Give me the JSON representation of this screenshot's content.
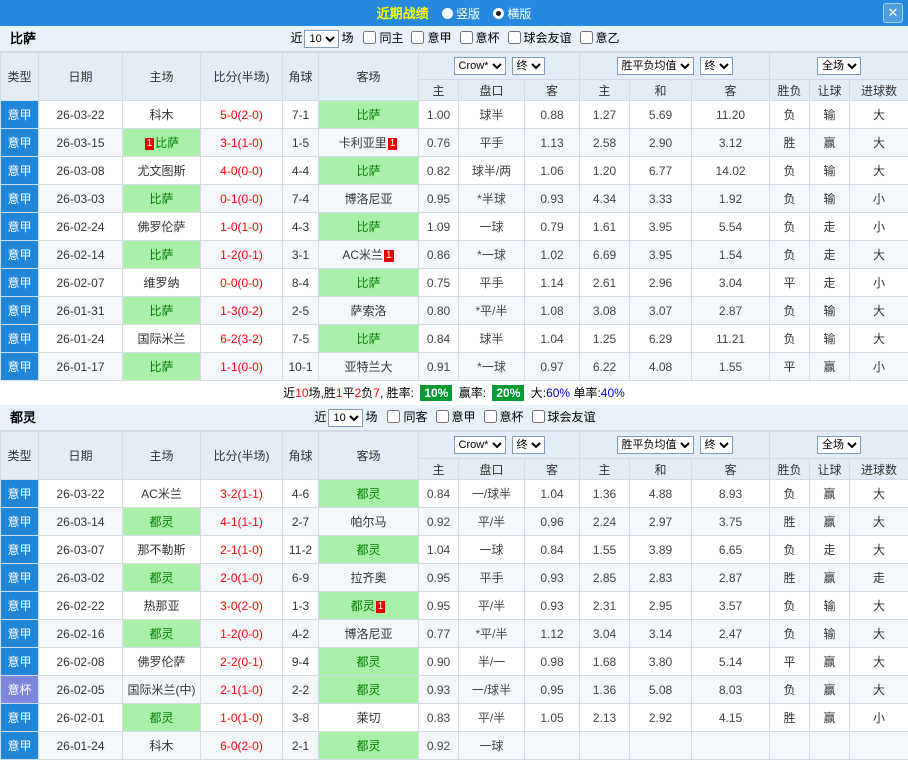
{
  "titlebar": {
    "title": "近期战绩",
    "options": [
      {
        "label": "竖版",
        "selected": false
      },
      {
        "label": "横版",
        "selected": true
      }
    ],
    "close_icon": "✕"
  },
  "controls_labels": {
    "near": "近",
    "count": "10",
    "games": "场"
  },
  "table_header": {
    "cols": [
      "类型",
      "日期",
      "主场",
      "比分(半场)",
      "角球",
      "客场"
    ],
    "odds_select": "Crow*",
    "final_select": "终",
    "avg_select": "胜平负均值",
    "avg_final_select": "终",
    "scope_select": "全场",
    "odds_cols": [
      "主",
      "盘口",
      "客"
    ],
    "avg_cols": [
      "主",
      "和",
      "客"
    ],
    "result_cols": [
      "胜负",
      "让球",
      "进球数"
    ]
  },
  "colors": {
    "titlebar_bg": "#2589e0",
    "league_cell": "#2186d7",
    "cup_cell": "#7d88dd",
    "team_highlight": "#a9f0a9",
    "score_text": "#ff0000",
    "win": "#ff0000",
    "draw": "#0000e0",
    "loss": "#009933",
    "rate_badge_bg": "#009933"
  },
  "sections": [
    {
      "team": "比萨",
      "checkboxes": [
        {
          "label": "同主",
          "checked": false
        },
        {
          "label": "意甲",
          "checked": false
        },
        {
          "label": "意杯",
          "checked": false
        },
        {
          "label": "球会友谊",
          "checked": false
        },
        {
          "label": "意乙",
          "checked": false
        }
      ],
      "rows": [
        {
          "type": "意甲",
          "date": "26-03-22",
          "home": "科木",
          "home_hl": false,
          "home_badge": "",
          "score": "5-0(2-0)",
          "corner": "7-1",
          "away": "比萨",
          "away_hl": true,
          "away_badge": "",
          "odds": [
            "1.00",
            "球半",
            "0.88"
          ],
          "avg": [
            "1.27",
            "5.69",
            "11.20"
          ],
          "res": [
            [
              "负",
              "g"
            ],
            [
              "输",
              "g"
            ],
            [
              "大",
              "r"
            ]
          ]
        },
        {
          "type": "意甲",
          "date": "26-03-15",
          "home": "比萨",
          "home_hl": true,
          "home_badge": "1",
          "home_badge_pos": "before",
          "score": "3-1(1-0)",
          "corner": "1-5",
          "away": "卡利亚里",
          "away_hl": false,
          "away_badge": "1",
          "odds": [
            "0.76",
            "平手",
            "1.13"
          ],
          "avg": [
            "2.58",
            "2.90",
            "3.12"
          ],
          "res": [
            [
              "胜",
              "r"
            ],
            [
              "赢",
              "r"
            ],
            [
              "大",
              "r"
            ]
          ]
        },
        {
          "type": "意甲",
          "date": "26-03-08",
          "home": "尤文图斯",
          "home_hl": false,
          "home_badge": "",
          "score": "4-0(0-0)",
          "corner": "4-4",
          "away": "比萨",
          "away_hl": true,
          "away_badge": "",
          "odds": [
            "0.82",
            "球半/两",
            "1.06"
          ],
          "avg": [
            "1.20",
            "6.77",
            "14.02"
          ],
          "res": [
            [
              "负",
              "g"
            ],
            [
              "输",
              "g"
            ],
            [
              "大",
              "r"
            ]
          ]
        },
        {
          "type": "意甲",
          "date": "26-03-03",
          "home": "比萨",
          "home_hl": true,
          "home_badge": "",
          "score": "0-1(0-0)",
          "corner": "7-4",
          "away": "博洛尼亚",
          "away_hl": false,
          "away_badge": "",
          "odds": [
            "0.95",
            "*半球",
            "0.93"
          ],
          "avg": [
            "4.34",
            "3.33",
            "1.92"
          ],
          "res": [
            [
              "负",
              "g"
            ],
            [
              "输",
              "g"
            ],
            [
              "小",
              "g"
            ]
          ]
        },
        {
          "type": "意甲",
          "date": "26-02-24",
          "home": "佛罗伦萨",
          "home_hl": false,
          "home_badge": "",
          "score": "1-0(1-0)",
          "corner": "4-3",
          "away": "比萨",
          "away_hl": true,
          "away_badge": "",
          "odds": [
            "1.09",
            "一球",
            "0.79"
          ],
          "avg": [
            "1.61",
            "3.95",
            "5.54"
          ],
          "res": [
            [
              "负",
              "g"
            ],
            [
              "走",
              "b"
            ],
            [
              "小",
              "g"
            ]
          ]
        },
        {
          "type": "意甲",
          "date": "26-02-14",
          "home": "比萨",
          "home_hl": true,
          "home_badge": "",
          "score": "1-2(0-1)",
          "corner": "3-1",
          "away": "AC米兰",
          "away_hl": false,
          "away_badge": "1",
          "odds": [
            "0.86",
            "*一球",
            "1.02"
          ],
          "avg": [
            "6.69",
            "3.95",
            "1.54"
          ],
          "res": [
            [
              "负",
              "g"
            ],
            [
              "走",
              "b"
            ],
            [
              "大",
              "r"
            ]
          ]
        },
        {
          "type": "意甲",
          "date": "26-02-07",
          "home": "维罗纳",
          "home_hl": false,
          "home_badge": "",
          "score": "0-0(0-0)",
          "corner": "8-4",
          "away": "比萨",
          "away_hl": true,
          "away_badge": "",
          "odds": [
            "0.75",
            "平手",
            "1.14"
          ],
          "avg": [
            "2.61",
            "2.96",
            "3.04"
          ],
          "res": [
            [
              "平",
              "b"
            ],
            [
              "走",
              "b"
            ],
            [
              "小",
              "g"
            ]
          ]
        },
        {
          "type": "意甲",
          "date": "26-01-31",
          "home": "比萨",
          "home_hl": true,
          "home_badge": "",
          "score": "1-3(0-2)",
          "corner": "2-5",
          "away": "萨索洛",
          "away_hl": false,
          "away_badge": "",
          "odds": [
            "0.80",
            "*平/半",
            "1.08"
          ],
          "avg": [
            "3.08",
            "3.07",
            "2.87"
          ],
          "res": [
            [
              "负",
              "g"
            ],
            [
              "输",
              "g"
            ],
            [
              "大",
              "r"
            ]
          ]
        },
        {
          "type": "意甲",
          "date": "26-01-24",
          "home": "国际米兰",
          "home_hl": false,
          "home_badge": "",
          "score": "6-2(3-2)",
          "corner": "7-5",
          "away": "比萨",
          "away_hl": true,
          "away_badge": "",
          "odds": [
            "0.84",
            "球半",
            "1.04"
          ],
          "avg": [
            "1.25",
            "6.29",
            "11.21"
          ],
          "res": [
            [
              "负",
              "g"
            ],
            [
              "输",
              "g"
            ],
            [
              "大",
              "r"
            ]
          ]
        },
        {
          "type": "意甲",
          "date": "26-01-17",
          "home": "比萨",
          "home_hl": true,
          "home_badge": "",
          "score": "1-1(0-0)",
          "corner": "10-1",
          "away": "亚特兰大",
          "away_hl": false,
          "away_badge": "",
          "odds": [
            "0.91",
            "*一球",
            "0.97"
          ],
          "avg": [
            "6.22",
            "4.08",
            "1.55"
          ],
          "res": [
            [
              "平",
              "b"
            ],
            [
              "赢",
              "r"
            ],
            [
              "小",
              "g"
            ]
          ]
        }
      ],
      "summary": [
        {
          "t": "近",
          "c": "k"
        },
        {
          "t": "10",
          "c": "r"
        },
        {
          "t": "场,胜",
          "c": "k"
        },
        {
          "t": "1",
          "c": "r"
        },
        {
          "t": "平",
          "c": "k"
        },
        {
          "t": "2",
          "c": "r"
        },
        {
          "t": "负",
          "c": "k"
        },
        {
          "t": "7",
          "c": "r"
        },
        {
          "t": ", 胜率: ",
          "c": "k"
        },
        {
          "t": "10%",
          "c": "box"
        },
        {
          "t": " 赢率: ",
          "c": "k"
        },
        {
          "t": "20%",
          "c": "box"
        },
        {
          "t": " 大:",
          "c": "k"
        },
        {
          "t": "60%",
          "c": "b"
        },
        {
          "t": " 单率:",
          "c": "k"
        },
        {
          "t": "40%",
          "c": "b"
        }
      ]
    },
    {
      "team": "都灵",
      "checkboxes": [
        {
          "label": "同客",
          "checked": false
        },
        {
          "label": "意甲",
          "checked": false
        },
        {
          "label": "意杯",
          "checked": false
        },
        {
          "label": "球会友谊",
          "checked": false
        }
      ],
      "rows": [
        {
          "type": "意甲",
          "date": "26-03-22",
          "home": "AC米兰",
          "home_hl": false,
          "home_badge": "",
          "score": "3-2(1-1)",
          "corner": "4-6",
          "away": "都灵",
          "away_hl": true,
          "away_badge": "",
          "odds": [
            "0.84",
            "一/球半",
            "1.04"
          ],
          "avg": [
            "1.36",
            "4.88",
            "8.93"
          ],
          "res": [
            [
              "负",
              "g"
            ],
            [
              "赢",
              "r"
            ],
            [
              "大",
              "r"
            ]
          ]
        },
        {
          "type": "意甲",
          "date": "26-03-14",
          "home": "都灵",
          "home_hl": true,
          "home_badge": "",
          "score": "4-1(1-1)",
          "corner": "2-7",
          "away": "帕尔马",
          "away_hl": false,
          "away_badge": "",
          "odds": [
            "0.92",
            "平/半",
            "0.96"
          ],
          "avg": [
            "2.24",
            "2.97",
            "3.75"
          ],
          "res": [
            [
              "胜",
              "r"
            ],
            [
              "赢",
              "r"
            ],
            [
              "大",
              "r"
            ]
          ]
        },
        {
          "type": "意甲",
          "date": "26-03-07",
          "home": "那不勒斯",
          "home_hl": false,
          "home_badge": "",
          "score": "2-1(1-0)",
          "corner": "11-2",
          "away": "都灵",
          "away_hl": true,
          "away_badge": "",
          "odds": [
            "1.04",
            "一球",
            "0.84"
          ],
          "avg": [
            "1.55",
            "3.89",
            "6.65"
          ],
          "res": [
            [
              "负",
              "g"
            ],
            [
              "走",
              "b"
            ],
            [
              "大",
              "r"
            ]
          ]
        },
        {
          "type": "意甲",
          "date": "26-03-02",
          "home": "都灵",
          "home_hl": true,
          "home_badge": "",
          "score": "2-0(1-0)",
          "corner": "6-9",
          "away": "拉齐奥",
          "away_hl": false,
          "away_badge": "",
          "odds": [
            "0.95",
            "平手",
            "0.93"
          ],
          "avg": [
            "2.85",
            "2.83",
            "2.87"
          ],
          "res": [
            [
              "胜",
              "r"
            ],
            [
              "赢",
              "r"
            ],
            [
              "走",
              "b"
            ]
          ]
        },
        {
          "type": "意甲",
          "date": "26-02-22",
          "home": "热那亚",
          "home_hl": false,
          "home_badge": "",
          "score": "3-0(2-0)",
          "corner": "1-3",
          "away": "都灵",
          "away_hl": true,
          "away_badge": "1",
          "odds": [
            "0.95",
            "平/半",
            "0.93"
          ],
          "avg": [
            "2.31",
            "2.95",
            "3.57"
          ],
          "res": [
            [
              "负",
              "g"
            ],
            [
              "输",
              "g"
            ],
            [
              "大",
              "r"
            ]
          ]
        },
        {
          "type": "意甲",
          "date": "26-02-16",
          "home": "都灵",
          "home_hl": true,
          "home_badge": "",
          "score": "1-2(0-0)",
          "corner": "4-2",
          "away": "博洛尼亚",
          "away_hl": false,
          "away_badge": "",
          "odds": [
            "0.77",
            "*平/半",
            "1.12"
          ],
          "avg": [
            "3.04",
            "3.14",
            "2.47"
          ],
          "res": [
            [
              "负",
              "g"
            ],
            [
              "输",
              "g"
            ],
            [
              "大",
              "r"
            ]
          ]
        },
        {
          "type": "意甲",
          "date": "26-02-08",
          "home": "佛罗伦萨",
          "home_hl": false,
          "home_badge": "",
          "score": "2-2(0-1)",
          "corner": "9-4",
          "away": "都灵",
          "away_hl": true,
          "away_badge": "",
          "odds": [
            "0.90",
            "半/一",
            "0.98"
          ],
          "avg": [
            "1.68",
            "3.80",
            "5.14"
          ],
          "res": [
            [
              "平",
              "b"
            ],
            [
              "赢",
              "r"
            ],
            [
              "大",
              "r"
            ]
          ]
        },
        {
          "type": "意杯",
          "date": "26-02-05",
          "home": "国际米兰(中)",
          "home_hl": false,
          "home_badge": "",
          "score": "2-1(1-0)",
          "corner": "2-2",
          "away": "都灵",
          "away_hl": true,
          "away_badge": "",
          "odds": [
            "0.93",
            "一/球半",
            "0.95"
          ],
          "avg": [
            "1.36",
            "5.08",
            "8.03"
          ],
          "res": [
            [
              "负",
              "g"
            ],
            [
              "赢",
              "r"
            ],
            [
              "大",
              "r"
            ]
          ]
        },
        {
          "type": "意甲",
          "date": "26-02-01",
          "home": "都灵",
          "home_hl": true,
          "home_badge": "",
          "score": "1-0(1-0)",
          "corner": "3-8",
          "away": "莱切",
          "away_hl": false,
          "away_badge": "",
          "odds": [
            "0.83",
            "平/半",
            "1.05"
          ],
          "avg": [
            "2.13",
            "2.92",
            "4.15"
          ],
          "res": [
            [
              "胜",
              "r"
            ],
            [
              "赢",
              "r"
            ],
            [
              "小",
              "g"
            ]
          ]
        },
        {
          "type": "意甲",
          "date": "26-01-24",
          "home": "科木",
          "home_hl": false,
          "home_badge": "",
          "score": "6-0(2-0)",
          "corner": "2-1",
          "away": "都灵",
          "away_hl": true,
          "away_badge": "",
          "odds": [
            "0.92",
            "一球",
            ""
          ],
          "avg": [
            "",
            "",
            ""
          ],
          "res": [
            [
              "",
              ""
            ],
            [
              "",
              ""
            ],
            [
              "",
              ""
            ]
          ]
        }
      ],
      "summary": null
    }
  ]
}
